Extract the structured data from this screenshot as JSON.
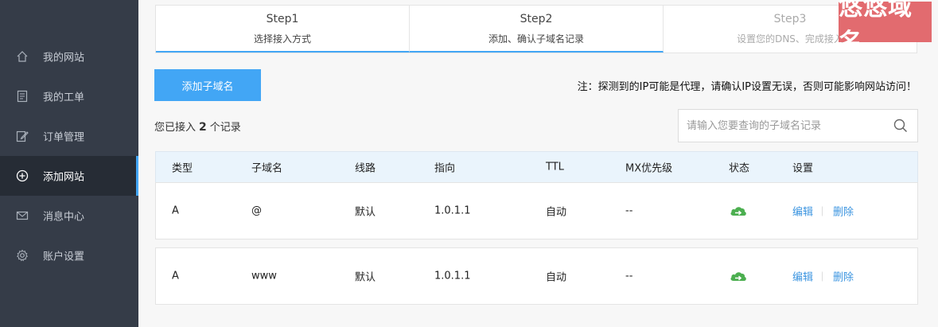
{
  "sidebar": {
    "items": [
      {
        "label": "我的网站",
        "icon": "home-icon"
      },
      {
        "label": "我的工单",
        "icon": "document-icon"
      },
      {
        "label": "订单管理",
        "icon": "edit-icon"
      },
      {
        "label": "添加网站",
        "icon": "plus-circle-icon",
        "active": true
      },
      {
        "label": "消息中心",
        "icon": "mail-icon"
      },
      {
        "label": "账户设置",
        "icon": "gear-icon"
      }
    ]
  },
  "steps": [
    {
      "title": "Step1",
      "desc": "选择接入方式",
      "state": "done"
    },
    {
      "title": "Step2",
      "desc": "添加、确认子域名记录",
      "state": "current"
    },
    {
      "title": "Step3",
      "desc": "设置您的DNS、完成接入",
      "state": "pending"
    }
  ],
  "watermark": "悠悠域名",
  "add_button": "添加子域名",
  "notice": "注：探测到的IP可能是代理，请确认IP设置无误，否则可能影响网站访问！",
  "count": {
    "prefix": "您已接入",
    "value": "2",
    "suffix": "个记录"
  },
  "search": {
    "placeholder": "请输入您要查询的子域名记录"
  },
  "table": {
    "headers": [
      "类型",
      "子域名",
      "线路",
      "指向",
      "TTL",
      "MX优先级",
      "状态",
      "设置"
    ],
    "rows": [
      {
        "type": "A",
        "subdomain": "@",
        "line": "默认",
        "target": "1.0.1.1",
        "ttl": "自动",
        "mx": "--",
        "status": "cloud-icon",
        "edit": "编辑",
        "delete": "删除"
      },
      {
        "type": "A",
        "subdomain": "www",
        "line": "默认",
        "target": "1.0.1.1",
        "ttl": "自动",
        "mx": "--",
        "status": "cloud-icon",
        "edit": "编辑",
        "delete": "删除"
      }
    ]
  },
  "colors": {
    "accent": "#42a6f5",
    "sidebar": "#353c48",
    "sidebar_active": "#262c35",
    "status_green": "#4caf50",
    "watermark": "#e26b6f"
  }
}
